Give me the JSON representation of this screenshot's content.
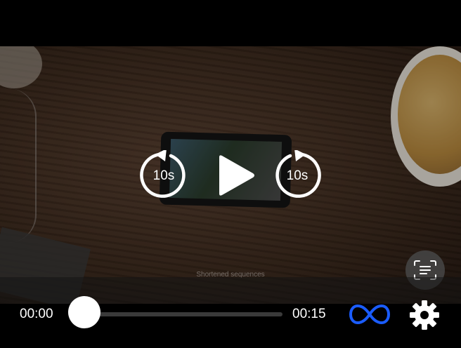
{
  "video": {
    "caption": "Shortened sequences"
  },
  "controls": {
    "skip_back_label": "10s",
    "skip_forward_label": "10s",
    "current_time": "00:00",
    "duration": "00:15",
    "progress": 0,
    "accent_color": "#1a5cff"
  },
  "icons": {
    "play": "play-icon",
    "scan": "scan-text-icon",
    "loop": "infinity-loop-icon",
    "settings": "gear-icon"
  }
}
